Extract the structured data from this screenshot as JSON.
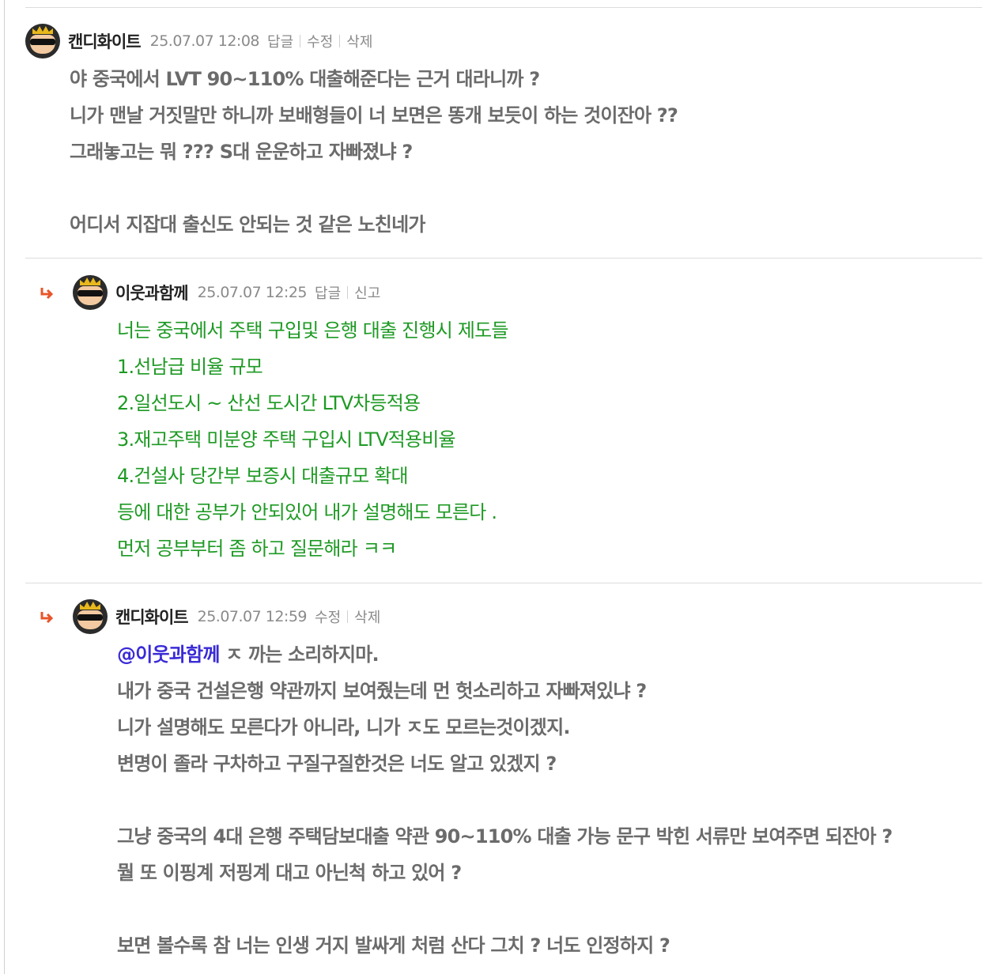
{
  "comments": [
    {
      "username": "캔디화이트",
      "timestamp": "25.07.07 12:08",
      "actions": [
        "답글",
        "수정",
        "삭제"
      ],
      "lines": [
        "야 중국에서 LVT 90~110% 대출해준다는 근거 대라니까 ?",
        "니가 맨날 거짓말만 하니까 보배형들이 너 보면은 똥개 보듯이 하는 것이잔아 ??",
        "그래놓고는 뭐 ??? S대 운운하고 자빠졌냐 ?",
        "",
        "어디서 지잡대 출신도 안되는 것 같은 노친네가"
      ]
    },
    {
      "username": "이웃과함께",
      "timestamp": "25.07.07 12:25",
      "actions": [
        "답글",
        "신고"
      ],
      "lines": [
        "너는 중국에서 주택 구입및 은행 대출 진행시 제도들",
        "1.선남급 비율 규모",
        "2.일선도시 ~ 산선 도시간 LTV차등적용",
        "3.재고주택 미분양 주택 구입시 LTV적용비율",
        "4.건설사 당간부 보증시 대출규모 확대",
        "등에 대한 공부가 안되있어 내가 설명해도 모른다 .",
        "먼저 공부부터 좀 하고 질문해라 ㅋㅋ"
      ]
    },
    {
      "username": "캔디화이트",
      "timestamp": "25.07.07 12:59",
      "actions": [
        "수정",
        "삭제"
      ],
      "mention": "@이웃과함께",
      "first_line_rest": " ㅈ 까는 소리하지마.",
      "lines": [
        "내가 중국 건설은행 약관까지 보여줬는데 먼 헛소리하고 자빠져있냐 ?",
        "니가 설명해도 모른다가 아니라, 니가 ㅈ도 모르는것이겠지.",
        "변명이 졸라 구차하고 구질구질한것은 너도 알고 있겠지 ?",
        "",
        "그냥 중국의 4대 은행 주택담보대출 약관 90~110% 대출 가능 문구 박힌 서류만 보여주면 되잔아 ?",
        "뭘 또 이핑계 저핑계 대고 아닌척 하고 있어 ?",
        "",
        "보면 볼수록 참 너는 인생 거지 발싸게 처럼 산다 그치 ? 너도 인정하지 ?"
      ]
    }
  ],
  "colors": {
    "reply_arrow": "#e8542a",
    "reply_text": "#1e9a24",
    "mention": "#3a2bd6",
    "body_text": "#6b6b6b"
  }
}
